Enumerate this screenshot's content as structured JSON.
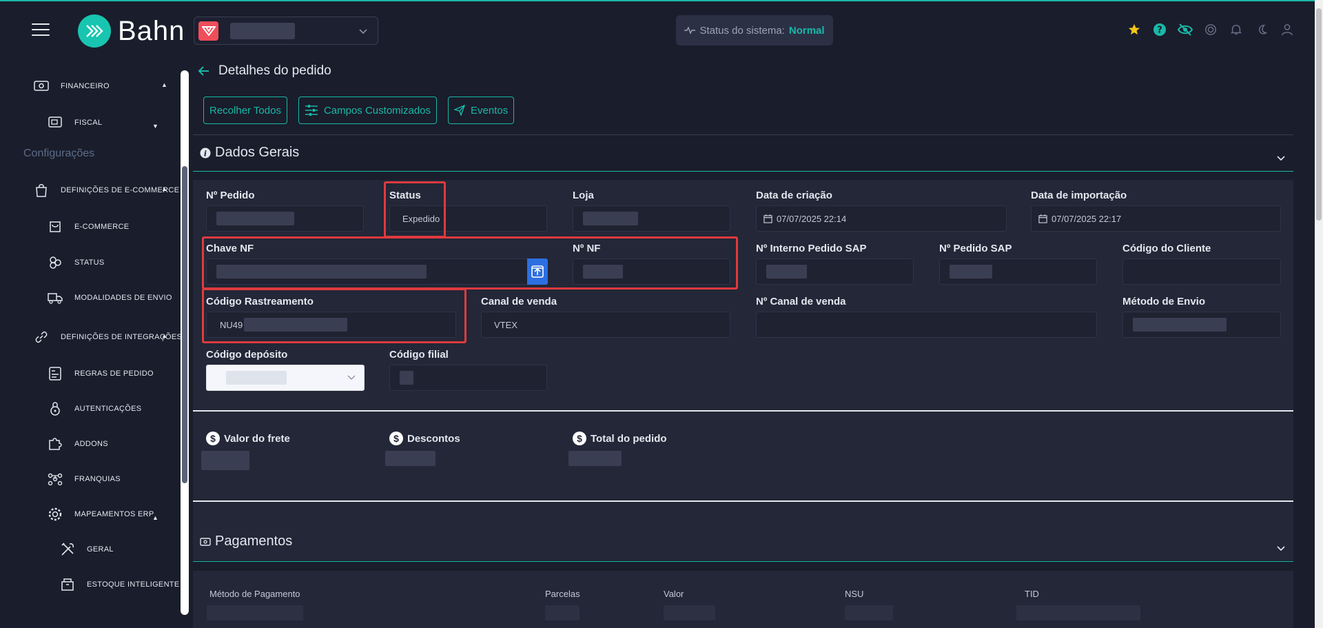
{
  "header": {
    "brand": "Bahn",
    "system_status_label": "Status do sistema:",
    "system_status_value": "Normal"
  },
  "sidebar": {
    "items": [
      {
        "label": "Financeiro",
        "icon": "money-icon"
      },
      {
        "label": "Fiscal",
        "icon": "receipt-icon"
      },
      {
        "label": "Definições de E-commerce",
        "icon": "shopping-bag-icon"
      },
      {
        "label": "E-commerce",
        "icon": "basket-icon"
      },
      {
        "label": "Status",
        "icon": "circles-icon"
      },
      {
        "label": "Modalidades de envio",
        "icon": "truck-icon"
      },
      {
        "label": "Definições de integrações",
        "icon": "link-icon"
      },
      {
        "label": "Regras de pedido",
        "icon": "rules-icon"
      },
      {
        "label": "Autenticações",
        "icon": "lock-icon"
      },
      {
        "label": "Addons",
        "icon": "puzzle-icon"
      },
      {
        "label": "Franquias",
        "icon": "network-icon"
      },
      {
        "label": "Mapeamentos ERP",
        "icon": "gear-icon"
      },
      {
        "label": "Geral",
        "icon": "tools-icon"
      },
      {
        "label": "Estoque inteligente",
        "icon": "box-icon"
      }
    ],
    "section_label": "Configurações"
  },
  "main": {
    "page_title": "Detalhes do pedido",
    "buttons": {
      "collapse_all": "Recolher Todos",
      "custom_fields": "Campos Customizados",
      "events": "Eventos"
    },
    "general": {
      "title": "Dados Gerais",
      "fields": {
        "order_no": "Nº Pedido",
        "status": "Status",
        "status_value": "Expedido",
        "store": "Loja",
        "created": "Data de criação",
        "created_value": "07/07/2025 22:14",
        "imported": "Data de importação",
        "imported_value": "07/07/2025 22:17",
        "nf_key": "Chave NF",
        "nf_no": "Nº NF",
        "sap_internal": "Nº Interno Pedido SAP",
        "sap_order": "Nº Pedido SAP",
        "client_code": "Código do Cliente",
        "tracking": "Código Rastreamento",
        "tracking_value": "NU49",
        "sales_channel": "Canal de venda",
        "sales_channel_value": "VTEX",
        "sales_channel_no": "Nº Canal de venda",
        "shipping_method": "Método de Envio",
        "warehouse": "Código depósito",
        "branch": "Código filial"
      },
      "totals": {
        "freight": "Valor do frete",
        "discounts": "Descontos",
        "total": "Total do pedido"
      }
    },
    "payments": {
      "title": "Pagamentos",
      "columns": [
        "Método de Pagamento",
        "Parcelas",
        "Valor",
        "NSU",
        "TID"
      ]
    }
  },
  "colors": {
    "accent": "#19b8a8",
    "background": "#1a1d2b",
    "panel": "#232737",
    "highlight": "#e03a3e"
  }
}
